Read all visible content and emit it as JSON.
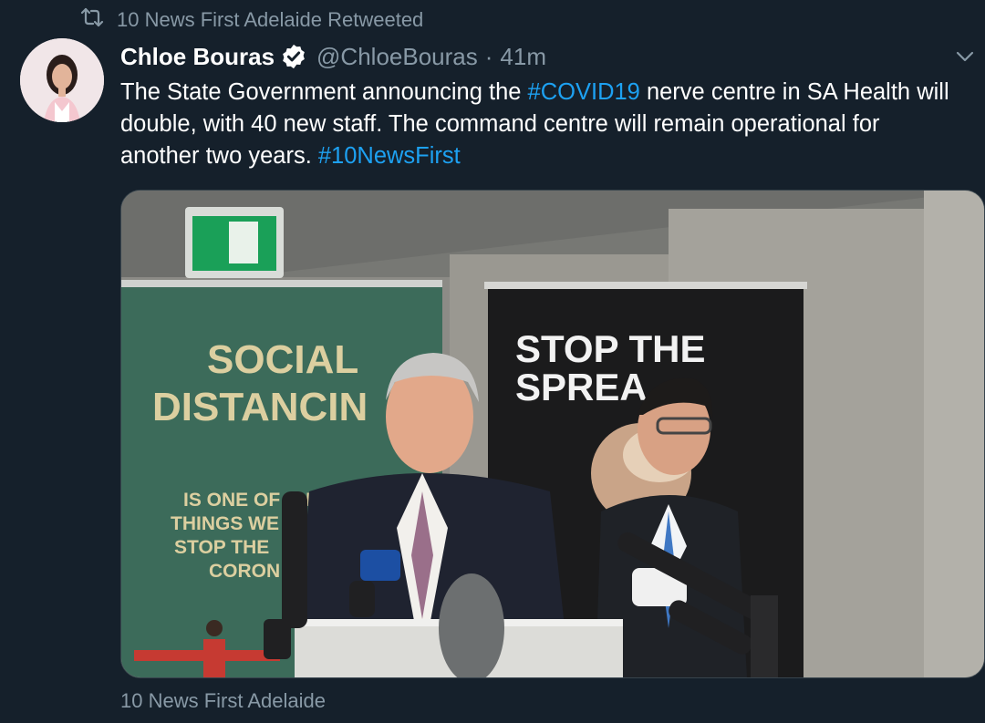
{
  "retweet": {
    "icon": "retweet-icon",
    "text": "10 News First Adelaide Retweeted"
  },
  "author": {
    "avatar": "avatar",
    "name": "Chloe Bouras",
    "verified_icon": "verified-badge-icon",
    "handle": "@ChloeBouras",
    "separator": "·",
    "time": "41m"
  },
  "menu_icon": "chevron-down-icon",
  "tweet": {
    "text_before": "The State Government announcing the ",
    "hashtag1": "#COVID19",
    "text_middle": " nerve centre in SA Health will double, with 40 new staff. The command centre will remain operational for another two years. ",
    "hashtag2": "#10NewsFirst"
  },
  "media": {
    "banner_left": {
      "line1": "SOCIAL",
      "line2": "DISTANCIN",
      "sub1": "IS ONE OF THE",
      "sub2": "THINGS WE",
      "sub3": "STOP THE",
      "sub4": "CORON"
    },
    "banner_right": {
      "line1": "STOP THE",
      "line2": "SPREA"
    }
  },
  "footer": {
    "source": "10 News First Adelaide"
  },
  "colors": {
    "background": "#15202b",
    "muted": "#8899a6",
    "link": "#1da1f2",
    "verified": "#ffffff"
  }
}
